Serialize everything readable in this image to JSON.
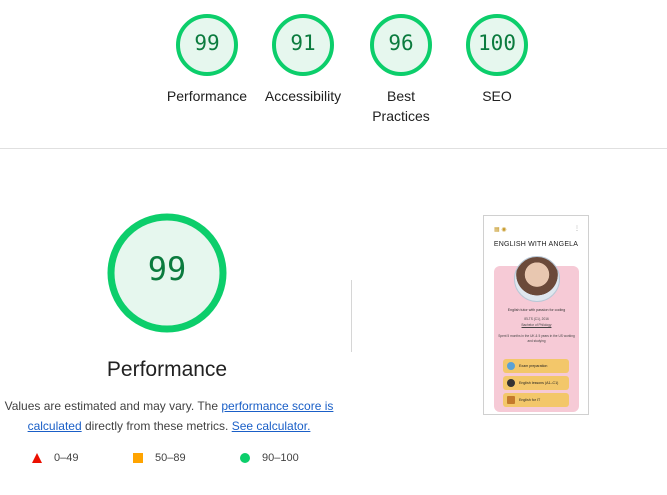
{
  "categories": [
    {
      "label": "Performance",
      "score": "99"
    },
    {
      "label": "Accessibility",
      "score": "91"
    },
    {
      "label": "Best Practices",
      "score": "96"
    },
    {
      "label": "SEO",
      "score": "100"
    }
  ],
  "main": {
    "score": "99",
    "title": "Performance",
    "desc_pre": "Values are estimated and may vary. The ",
    "desc_link1": "performance score is calculated",
    "desc_mid": " directly from these metrics. ",
    "desc_link2": "See calculator."
  },
  "legend": [
    {
      "range": "0–49",
      "color": "#eb0f00"
    },
    {
      "range": "50–89",
      "color": "#ffa400"
    },
    {
      "range": "90–100",
      "color": "#0cce6b"
    }
  ],
  "colors": {
    "pass": "#0cce6b",
    "pass_fill": "#e6f7ee",
    "pass_text": "#0b7b3e"
  },
  "thumbnail": {
    "site_title": "ENGLISH WITH ANGELA",
    "tagline": "English tutor with passion for coding",
    "line2": "IELTS (C1), 2016",
    "line3": "Bachelor of Philology",
    "line4": "Spent 5 months in the UK & 5 years in the US working and studying",
    "buttons": [
      "Exam preparation",
      "English lessons (A1–C1)",
      "English for IT"
    ]
  }
}
